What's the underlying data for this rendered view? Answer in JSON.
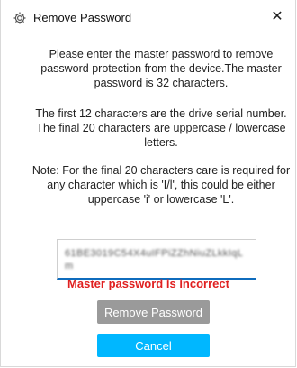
{
  "dialog": {
    "title": "Remove Password",
    "close_glyph": "✕",
    "paragraph1": "Please enter the master password to remove password protection from the device.The master password is 32 characters.",
    "paragraph2": "The first 12 characters are the drive serial number. The final 20 characters are uppercase / lowercase letters.",
    "paragraph3": "Note: For the final 20 characters care is required for any character which is 'I/l', this could be either uppercase 'i' or lowercase 'L'.",
    "password_value": "61BE3019C54X4uIFPiZZhNiuZLkkIqLm",
    "error_message": "Master password is incorrect",
    "remove_button_label": "Remove Password",
    "cancel_button_label": "Cancel"
  },
  "icons": {
    "title_icon": "gear-icon",
    "close_icon": "close-icon"
  },
  "colors": {
    "error": "#e02020",
    "remove_button": "#9a9a9a",
    "cancel_button": "#00b7ff",
    "field_focus": "#0f6cbd"
  }
}
